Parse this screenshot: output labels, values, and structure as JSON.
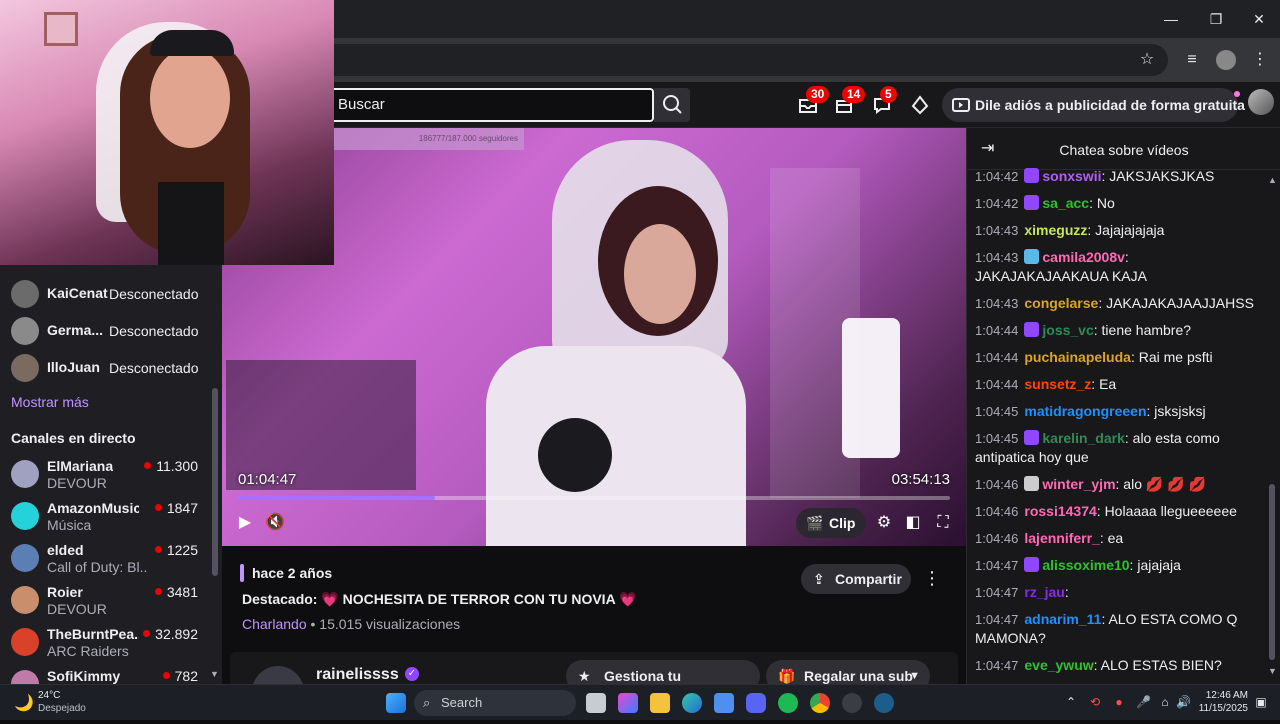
{
  "header": {
    "search_placeholder": "Buscar",
    "badges": {
      "inbox": "30",
      "prime": "14",
      "whispers": "5"
    },
    "adfree_label": "Dile adiós a publicidad de forma gratuita"
  },
  "sidebar": {
    "followed": [
      {
        "name": "KaiCenat",
        "status": "Desconectado"
      },
      {
        "name": "Germa...",
        "status": "Desconectado"
      },
      {
        "name": "IlloJuan",
        "status": "Desconectado"
      }
    ],
    "show_more": "Mostrar más",
    "live_heading": "Canales en directo",
    "live": [
      {
        "name": "ElMariana",
        "game": "DEVOUR",
        "viewers": "11.300"
      },
      {
        "name": "AmazonMusic",
        "game": "Música",
        "viewers": "1847"
      },
      {
        "name": "elded",
        "game": "Call of Duty: Bl...",
        "viewers": "1225"
      },
      {
        "name": "Roier",
        "game": "DEVOUR",
        "viewers": "3481"
      },
      {
        "name": "TheBurntPea...",
        "game": "ARC Raiders",
        "viewers": "32.892"
      },
      {
        "name": "SofiKimmy",
        "game": "",
        "viewers": "782"
      }
    ]
  },
  "video": {
    "followers_overlay": "186777/187.000 seguidores",
    "current_time": "01:04:47",
    "duration": "03:54:13",
    "progress": 0.276,
    "clip_label": "Clip"
  },
  "info": {
    "age": "hace 2 años",
    "title": "Destacado: 💗 NOCHESITA DE TERROR CON TU NOVIA 💗",
    "category": "Charlando",
    "views": " • 15.015 visualizaciones",
    "share_label": "Compartir",
    "channel_name": "rainelissss",
    "manage_sub_label": "Gestiona tu suscripción",
    "gift_sub_label": "Regalar una sub"
  },
  "chat": {
    "title": "Chatea sobre vídeos",
    "messages": [
      {
        "time": "1:04:42",
        "user": "sonxswii",
        "color": "#b05ff2",
        "badge": "#9146ff",
        "text": "JAKSJAKSJKAS"
      },
      {
        "time": "1:04:42",
        "user": "sa_acc",
        "color": "#2ec12e",
        "badge": "#9146ff",
        "text": "No"
      },
      {
        "time": "1:04:43",
        "user": "ximeguzz",
        "color": "#c7e55a",
        "badge": "",
        "text": "Jajajajajaja"
      },
      {
        "time": "1:04:43",
        "user": "camila2008v",
        "color": "#ff69b4",
        "badge": "#5bb9e8",
        "text": "JAKAJAKAJAAKAUA KAJA"
      },
      {
        "time": "1:04:43",
        "user": "congelarse",
        "color": "#daa520",
        "badge": "",
        "text": "JAKAJAKAJAAJJAHSS"
      },
      {
        "time": "1:04:44",
        "user": "joss_vc",
        "color": "#2e8b57",
        "badge": "#9146ff",
        "text": "tiene hambre?"
      },
      {
        "time": "1:04:44",
        "user": "puchainapeluda",
        "color": "#daa520",
        "badge": "",
        "text": "Rai me psfti"
      },
      {
        "time": "1:04:44",
        "user": "sunsetz_z",
        "color": "#ff4500",
        "badge": "",
        "text": "Ea"
      },
      {
        "time": "1:04:45",
        "user": "matidragongreeen",
        "color": "#1e90ff",
        "badge": "",
        "text": "jsksjsksj"
      },
      {
        "time": "1:04:45",
        "user": "karelin_dark",
        "color": "#2e8b57",
        "badge": "#9146ff",
        "text": "alo esta como antipatica hoy que"
      },
      {
        "time": "1:04:46",
        "user": "winter_yjm",
        "color": "#ff69b4",
        "badge": "#cccccc",
        "text": "alo 💋 💋 💋"
      },
      {
        "time": "1:04:46",
        "user": "rossi14374",
        "color": "#ff69b4",
        "badge": "",
        "text": "Holaaaa llegueeeeee"
      },
      {
        "time": "1:04:46",
        "user": "lajenniferr_",
        "color": "#ff69b4",
        "badge": "",
        "text": "ea"
      },
      {
        "time": "1:04:47",
        "user": "alissoxime10",
        "color": "#2ec12e",
        "badge": "#9146ff",
        "text": "jajajaja"
      },
      {
        "time": "1:04:47",
        "user": "rz_jau",
        "color": "#8a2be2",
        "badge": "",
        "text": ""
      },
      {
        "time": "1:04:47",
        "user": "adnarim_11",
        "color": "#1e90ff",
        "badge": "",
        "text": "ALO ESTA COMO Q MAMONA?"
      },
      {
        "time": "1:04:47",
        "user": "eve_ywuw",
        "color": "#2ec12e",
        "badge": "",
        "text": "ALO ESTAS BIEN?"
      }
    ]
  },
  "taskbar": {
    "weather_temp": "24°C",
    "weather_desc": "Despejado",
    "search_label": "Search",
    "time": "12:46 AM",
    "date": "11/15/2025"
  },
  "colors": {
    "accent": "#9146ff",
    "live": "#eb0400",
    "bg": "#0e0e10"
  }
}
